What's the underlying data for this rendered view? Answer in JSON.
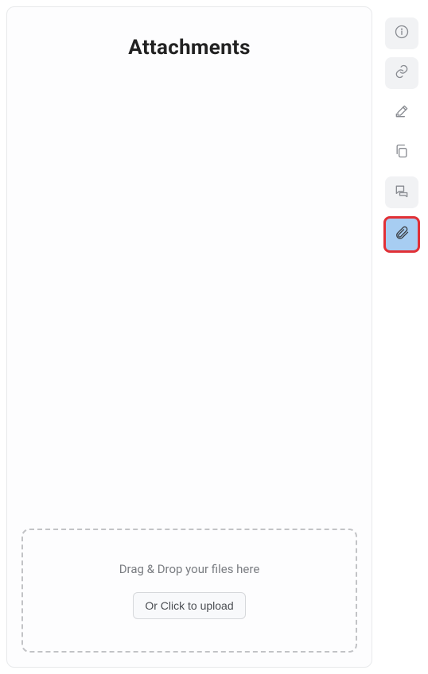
{
  "title": "Attachments",
  "dropzone": {
    "hint": "Drag & Drop your files here",
    "button": "Or Click to upload"
  },
  "rail": {
    "info": "info-icon",
    "link": "link-icon",
    "edit": "edit-icon",
    "copy": "copy-icon",
    "comments": "comments-icon",
    "attachments": "paperclip-icon"
  }
}
